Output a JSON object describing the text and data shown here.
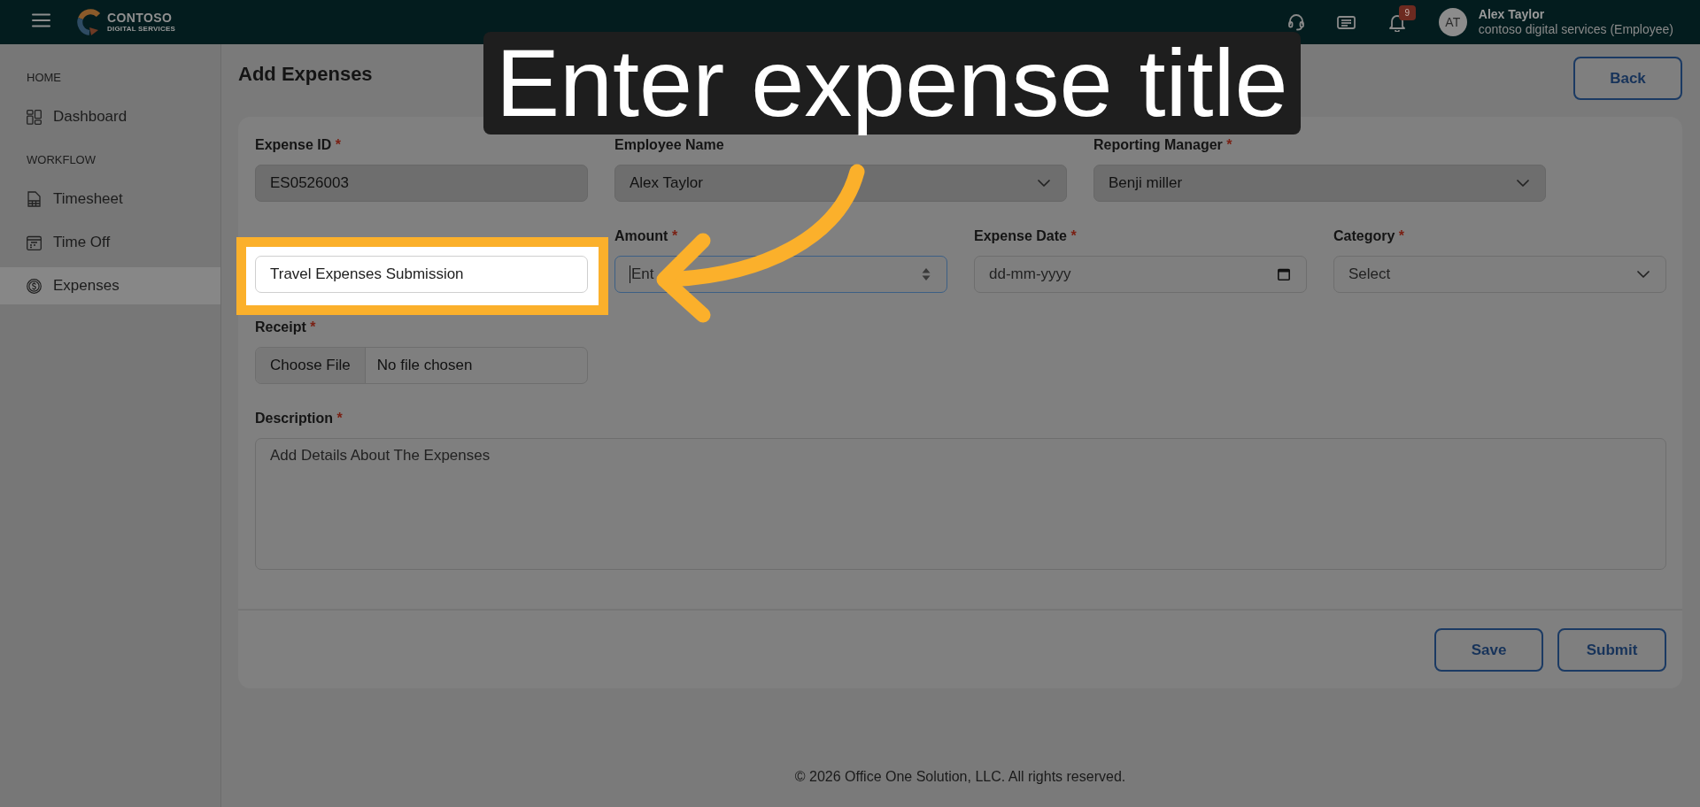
{
  "topbar": {
    "brand": {
      "name": "CONTOSO",
      "tagline": "DIGITAL SERVICES"
    },
    "notification_count": "9",
    "user": {
      "initials": "AT",
      "name": "Alex Taylor",
      "org": "contoso digital services (Employee)"
    }
  },
  "sidebar": {
    "sections": [
      {
        "heading": "HOME",
        "items": [
          {
            "label": "Dashboard",
            "selected": false
          }
        ]
      },
      {
        "heading": "WORKFLOW",
        "items": [
          {
            "label": "Timesheet",
            "selected": false
          },
          {
            "label": "Time Off",
            "selected": false
          },
          {
            "label": "Expenses",
            "selected": true
          }
        ]
      }
    ]
  },
  "page": {
    "title": "Add Expenses",
    "back_button": "Back"
  },
  "form": {
    "required_mark": "*",
    "rows": [
      [
        {
          "kind": "text",
          "label": "Expense ID",
          "required": true,
          "disabled": true,
          "focused": false,
          "highlighted": false,
          "value": "ES0526003"
        },
        {
          "kind": "select",
          "label": "Employee Name",
          "required": false,
          "disabled": true,
          "focused": false,
          "highlighted": false,
          "value": "Alex Taylor"
        },
        {
          "kind": "select",
          "label": "Reporting Manager",
          "required": true,
          "disabled": true,
          "focused": false,
          "highlighted": false,
          "value": "Benji miller"
        }
      ],
      [
        {
          "kind": "text",
          "disabled": false,
          "focused": false,
          "highlighted": true,
          "value": "Travel Expenses Submission"
        },
        {
          "kind": "number",
          "label": "Amount",
          "required": true,
          "disabled": false,
          "focused": true,
          "highlighted": false,
          "placeholder": "Ent"
        },
        {
          "kind": "date",
          "label": "Expense Date",
          "required": true,
          "disabled": false,
          "focused": false,
          "highlighted": false,
          "placeholder": "dd-mm-yyyy"
        },
        {
          "kind": "select",
          "label": "Category",
          "required": true,
          "disabled": false,
          "focused": false,
          "highlighted": false,
          "placeholder": "Select"
        }
      ],
      [
        {
          "kind": "file",
          "label": "Receipt",
          "required": true,
          "disabled": false,
          "focused": false,
          "highlighted": false,
          "button": "Choose File",
          "value": "No file chosen"
        }
      ],
      [
        {
          "kind": "textarea",
          "label": "Description",
          "required": true,
          "disabled": false,
          "focused": false,
          "highlighted": false,
          "placeholder": "Add Details About The Expenses"
        }
      ]
    ],
    "actions": [
      {
        "label": "Save"
      },
      {
        "label": "Submit"
      }
    ]
  },
  "footer": "© 2026 Office One Solution, LLC. All rights reserved.",
  "tutorial": {
    "callout": "Enter expense title"
  }
}
